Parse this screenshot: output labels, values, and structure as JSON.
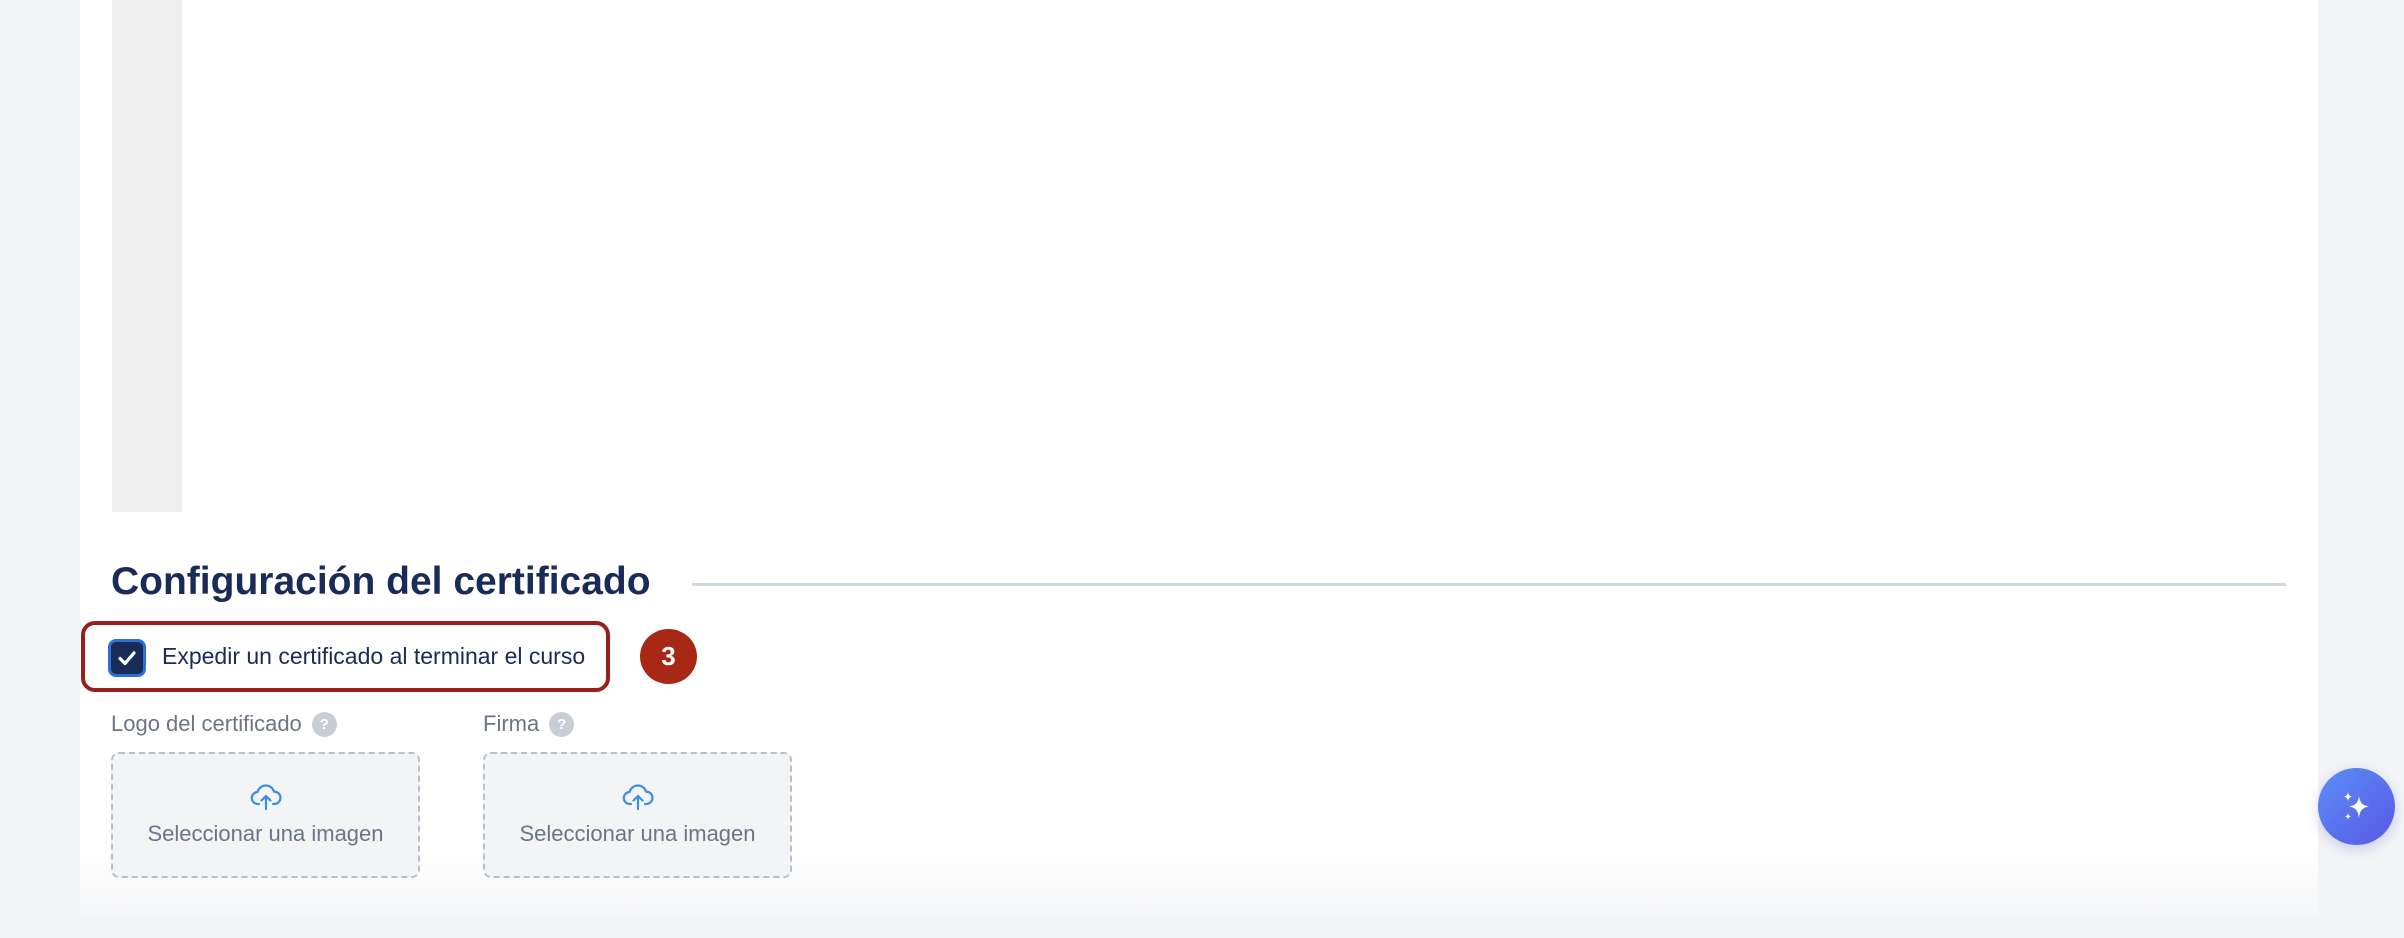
{
  "certificate_section": {
    "title": "Configuración del certificado",
    "issue_checkbox": {
      "label": "Expedir un certificado al terminar el curso",
      "checked": true
    },
    "step_badge": "3",
    "logo_field": {
      "label": "Logo del certificado",
      "help": "?",
      "upload_text": "Seleccionar una imagen",
      "icon": "cloud-upload-icon"
    },
    "signature_field": {
      "label": "Firma",
      "help": "?",
      "upload_text": "Seleccionar una imagen",
      "icon": "cloud-upload-icon"
    }
  },
  "ai_button": {
    "icon": "sparkles-icon"
  },
  "colors": {
    "heading": "#1b2b57",
    "highlight": "#9a1f1a",
    "badge": "#a62815",
    "upload_icon": "#3b8ee8",
    "fab_start": "#5b8ef5",
    "fab_end": "#5a57e6"
  }
}
